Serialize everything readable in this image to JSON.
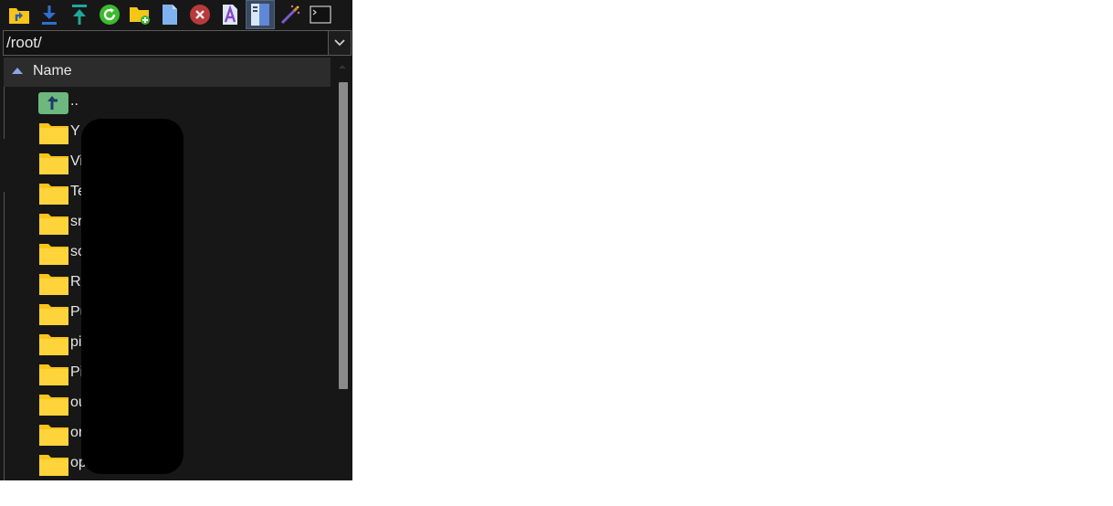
{
  "toolbar": {
    "buttons": [
      {
        "name": "parent-folder-icon",
        "color": "#f5c518"
      },
      {
        "name": "download-icon",
        "color": "#2f6fcf"
      },
      {
        "name": "upload-icon",
        "color": "#1fa89a"
      },
      {
        "name": "refresh-icon",
        "color": "#3cba2e"
      },
      {
        "name": "new-folder-icon",
        "color": "#f5c518"
      },
      {
        "name": "new-file-icon",
        "color": "#7fb3f0"
      },
      {
        "name": "delete-icon",
        "color": "#b83a3a"
      },
      {
        "name": "rename-icon",
        "color": "#8a45c9"
      },
      {
        "name": "toggle-panel-icon",
        "color": "#9ec0ef",
        "active": true
      },
      {
        "name": "magic-wand-icon",
        "color": "#d28b2a"
      },
      {
        "name": "terminal-icon",
        "color": "#cccccc"
      }
    ]
  },
  "path": {
    "value": "/root/"
  },
  "header": {
    "name_label": "Name",
    "sort": "ascending"
  },
  "files": [
    {
      "name": "..",
      "type": "parent"
    },
    {
      "name": "Y",
      "type": "folder"
    },
    {
      "name": "Vi",
      "type": "folder"
    },
    {
      "name": "Te",
      "type": "folder"
    },
    {
      "name": "sr",
      "type": "folder"
    },
    {
      "name": "sc",
      "type": "folder"
    },
    {
      "name": "Rl",
      "type": "folder"
    },
    {
      "name": "Pu",
      "type": "folder"
    },
    {
      "name": "pi",
      "type": "folder"
    },
    {
      "name": "Pi",
      "type": "folder"
    },
    {
      "name": "ou",
      "type": "folder"
    },
    {
      "name": "or",
      "type": "folder"
    },
    {
      "name": "op",
      "type": "folder"
    }
  ],
  "colors": {
    "folder": "#fcc419",
    "parent_icon_bg": "#6db87f",
    "background": "#171717"
  }
}
